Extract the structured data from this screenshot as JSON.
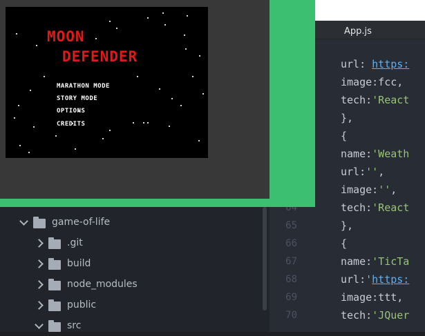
{
  "game": {
    "title_line1": "MOON",
    "title_line2": "DEFENDER",
    "menu": [
      "MARATHON MODE",
      "STORY MODE",
      "OPTIONS",
      "CREDITS"
    ]
  },
  "editor": {
    "active_tab": "App.js",
    "lines": [
      {
        "num": "",
        "parts": [
          [
            "url: ",
            "k"
          ],
          [
            "https:",
            "u"
          ]
        ]
      },
      {
        "num": "",
        "parts": [
          [
            "image:fcc,",
            "k"
          ]
        ]
      },
      {
        "num": "",
        "parts": [
          [
            "tech:",
            "k"
          ],
          [
            "'React",
            "s"
          ]
        ]
      },
      {
        "num": "",
        "parts": [
          [
            "},",
            "p"
          ]
        ]
      },
      {
        "num": "",
        "parts": [
          [
            "{",
            "p"
          ]
        ]
      },
      {
        "num": "",
        "parts": [
          [
            "name:",
            "k"
          ],
          [
            "'Weath",
            "s"
          ]
        ]
      },
      {
        "num": "",
        "parts": [
          [
            "url:",
            "k"
          ],
          [
            "''",
            "s"
          ],
          [
            ",",
            "p"
          ]
        ]
      },
      {
        "num": "",
        "parts": [
          [
            "image:",
            "k"
          ],
          [
            "''",
            "s"
          ],
          [
            ",",
            "p"
          ]
        ]
      },
      {
        "num": "64",
        "parts": [
          [
            "tech:",
            "k"
          ],
          [
            "'React",
            "s"
          ]
        ]
      },
      {
        "num": "65",
        "parts": [
          [
            "},",
            "p"
          ]
        ]
      },
      {
        "num": "66",
        "parts": [
          [
            "{",
            "p"
          ]
        ]
      },
      {
        "num": "67",
        "parts": [
          [
            "name:",
            "k"
          ],
          [
            "'TicTa",
            "s"
          ]
        ]
      },
      {
        "num": "68",
        "parts": [
          [
            "url:",
            "k"
          ],
          [
            "'",
            "s"
          ],
          [
            "https:",
            "u"
          ]
        ]
      },
      {
        "num": "69",
        "parts": [
          [
            "image:ttt,",
            "k"
          ]
        ]
      },
      {
        "num": "70",
        "parts": [
          [
            "tech:",
            "k"
          ],
          [
            "'JQuer",
            "s"
          ]
        ]
      }
    ]
  },
  "file_tree": {
    "items": [
      {
        "label": "game-of-life",
        "expanded": true,
        "depth": 0
      },
      {
        "label": ".git",
        "expanded": false,
        "depth": 1
      },
      {
        "label": "build",
        "expanded": false,
        "depth": 1
      },
      {
        "label": "node_modules",
        "expanded": false,
        "depth": 1
      },
      {
        "label": "public",
        "expanded": false,
        "depth": 1
      },
      {
        "label": "src",
        "expanded": true,
        "depth": 1
      }
    ]
  },
  "colors": {
    "green_frame": "#3dbf72",
    "title_red": "#e01a1a",
    "string_green": "#98c379",
    "link_blue": "#61afef"
  }
}
